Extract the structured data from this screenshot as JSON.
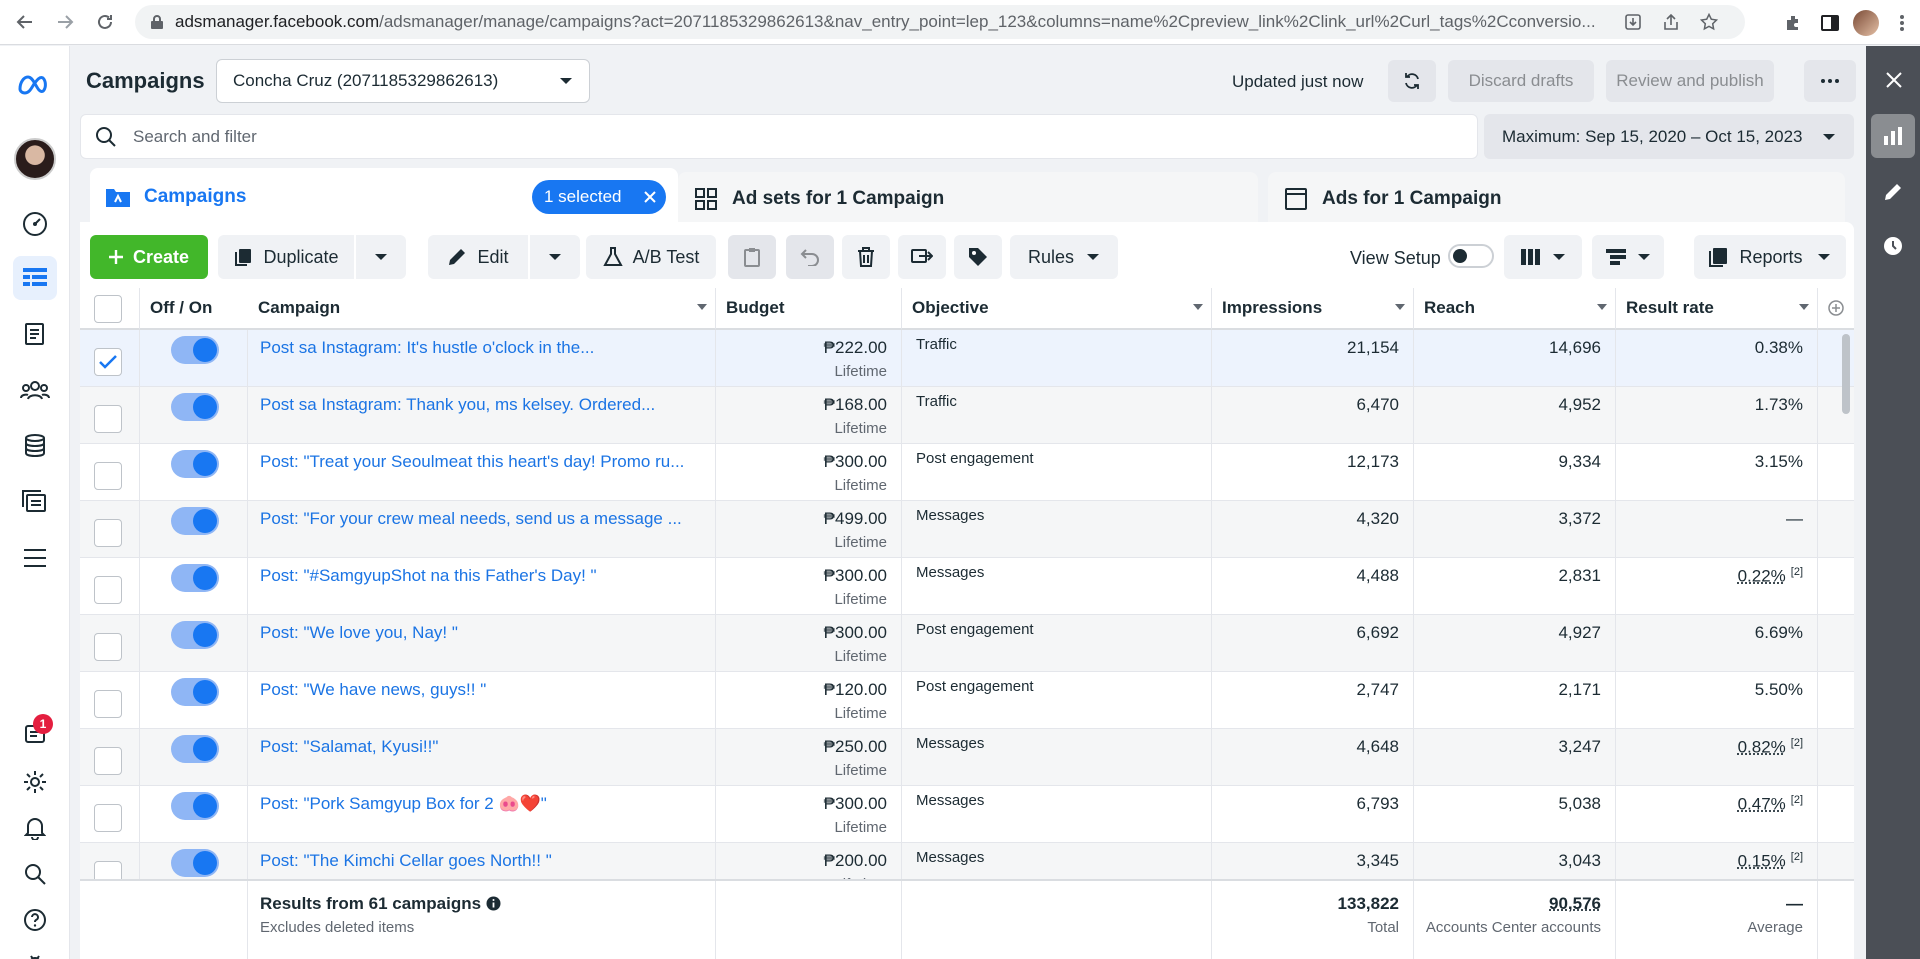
{
  "browser": {
    "url_host": "adsmanager.facebook.com",
    "url_path": "/adsmanager/manage/campaigns?act=2071185329862613&nav_entry_point=lep_123&columns=name%2Cpreview_link%2Clink_url%2Curl_tags%2Cconversio..."
  },
  "rail": {
    "notification_count": "1"
  },
  "header": {
    "title": "Campaigns",
    "account": "Concha Cruz (2071185329862613)",
    "updated": "Updated just now",
    "discard": "Discard drafts",
    "review": "Review and publish"
  },
  "search": {
    "placeholder": "Search and filter"
  },
  "date_range": "Maximum: Sep 15, 2020 – Oct 15, 2023",
  "tabs": {
    "campaigns": "Campaigns",
    "selected": "1 selected",
    "adsets": "Ad sets for 1 Campaign",
    "ads": "Ads for 1 Campaign"
  },
  "toolbar": {
    "create": "Create",
    "duplicate": "Duplicate",
    "edit": "Edit",
    "ab_test": "A/B Test",
    "rules": "Rules",
    "view_setup": "View Setup",
    "reports": "Reports"
  },
  "columns": {
    "offon": "Off / On",
    "campaign": "Campaign",
    "budget": "Budget",
    "objective": "Objective",
    "impressions": "Impressions",
    "reach": "Reach",
    "result_rate": "Result rate"
  },
  "rows": [
    {
      "name": "Post sa Instagram: It's hustle o'clock in the...",
      "budget": "₱222.00",
      "budget_type": "Lifetime",
      "objective": "Traffic",
      "impressions": "21,154",
      "reach": "14,696",
      "result_rate": "0.38%",
      "note": ""
    },
    {
      "name": "Post sa Instagram: Thank you, ms kelsey. Ordered...",
      "budget": "₱168.00",
      "budget_type": "Lifetime",
      "objective": "Traffic",
      "impressions": "6,470",
      "reach": "4,952",
      "result_rate": "1.73%",
      "note": ""
    },
    {
      "name": "Post: \"Treat your Seoulmeat this heart's day! Promo ru...",
      "budget": "₱300.00",
      "budget_type": "Lifetime",
      "objective": "Post engagement",
      "impressions": "12,173",
      "reach": "9,334",
      "result_rate": "3.15%",
      "note": ""
    },
    {
      "name": "Post: \"For your crew meal needs, send us a message ...",
      "budget": "₱499.00",
      "budget_type": "Lifetime",
      "objective": "Messages",
      "impressions": "4,320",
      "reach": "3,372",
      "result_rate": "—",
      "note": ""
    },
    {
      "name": "Post: \"#SamgyupShot na this Father's Day! \"",
      "budget": "₱300.00",
      "budget_type": "Lifetime",
      "objective": "Messages",
      "impressions": "4,488",
      "reach": "2,831",
      "result_rate": "0.22%",
      "note": "[2]"
    },
    {
      "name": "Post: \"We love you, Nay! \"",
      "budget": "₱300.00",
      "budget_type": "Lifetime",
      "objective": "Post engagement",
      "impressions": "6,692",
      "reach": "4,927",
      "result_rate": "6.69%",
      "note": ""
    },
    {
      "name": "Post: \"We have news, guys!! \"",
      "budget": "₱120.00",
      "budget_type": "Lifetime",
      "objective": "Post engagement",
      "impressions": "2,747",
      "reach": "2,171",
      "result_rate": "5.50%",
      "note": ""
    },
    {
      "name": "Post: \"Salamat, Kyusi!!\"",
      "budget": "₱250.00",
      "budget_type": "Lifetime",
      "objective": "Messages",
      "impressions": "4,648",
      "reach": "3,247",
      "result_rate": "0.82%",
      "note": "[2]"
    },
    {
      "name": "Post: \"Pork Samgyup Box for 2 🐽❤️\"",
      "budget": "₱300.00",
      "budget_type": "Lifetime",
      "objective": "Messages",
      "impressions": "6,793",
      "reach": "5,038",
      "result_rate": "0.47%",
      "note": "[2]"
    },
    {
      "name": "Post: \"The Kimchi Cellar goes North!! \"",
      "budget": "₱200.00",
      "budget_type": "Lifetime",
      "objective": "Messages",
      "impressions": "3,345",
      "reach": "3,043",
      "result_rate": "0.15%",
      "note": "[2]"
    }
  ],
  "footer": {
    "title": "Results from 61 campaigns",
    "subtitle": "Excludes deleted items",
    "impressions": "133,822",
    "impressions_label": "Total",
    "reach": "90,576",
    "reach_label": "Accounts Center accounts",
    "result_rate": "—",
    "result_rate_label": "Average"
  },
  "colors": {
    "accent": "#1877f2",
    "create": "#42b72a"
  }
}
